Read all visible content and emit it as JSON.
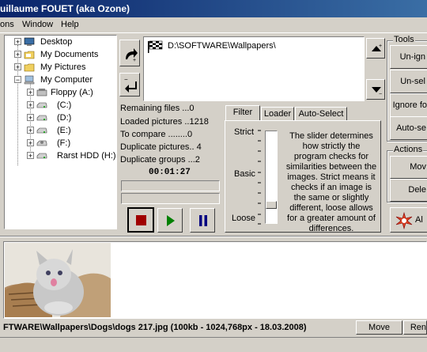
{
  "window": {
    "title": "uillaume FOUET (aka Ozone)"
  },
  "menu": {
    "items": [
      "ons",
      "Window",
      "Help"
    ]
  },
  "tree": {
    "items": [
      {
        "label": "Desktop",
        "icon": "desktop-icon"
      },
      {
        "label": "My Documents",
        "icon": "folder-icon"
      },
      {
        "label": "My Pictures",
        "icon": "folder-icon"
      },
      {
        "label": "My Computer",
        "icon": "computer-icon"
      },
      {
        "label": "Floppy (A:)",
        "icon": "floppy-icon"
      },
      {
        "label": "(C:)",
        "icon": "drive-icon"
      },
      {
        "label": "(D:)",
        "icon": "drive-icon"
      },
      {
        "label": "(E:)",
        "icon": "drive-icon"
      },
      {
        "label": "(F:)",
        "icon": "drive-icon"
      },
      {
        "label": "Rarst HDD (H:)",
        "icon": "drive-icon"
      }
    ]
  },
  "folders": {
    "path": "D:\\SOFTWARE\\Wallpapers\\"
  },
  "stats": {
    "remaining": "Remaining files ...0",
    "loaded": "Loaded pictures ..1218",
    "to_compare": "To compare ........0",
    "duplicates": "Duplicate pictures.. 4",
    "groups": "Duplicate groups ...2",
    "time": "00:01:27"
  },
  "tabs": [
    "Filter",
    "Loader",
    "Auto-Select"
  ],
  "filter": {
    "strict": "Strict",
    "basic": "Basic",
    "loose": "Loose",
    "description": "The slider determines how strictly the program checks for similarities between the images. Strict means it checks if an image is the same or slightly different, loose allows for a greater amount of differences."
  },
  "tools": {
    "title": "Tools",
    "buttons": [
      "Un-ign",
      "Un-sel",
      "Ignore fo",
      "Auto-se"
    ]
  },
  "actions": {
    "title": "Actions",
    "buttons": [
      "Mov",
      "Dele"
    ]
  },
  "bigbutton": {
    "label": "Al"
  },
  "status": {
    "path": "FTWARE\\Wallpapers\\Dogs\\dogs 217.jpg (100kb - 1024,768px - 18.03.2008)",
    "move": "Move",
    "rename": "Ren"
  },
  "colors": {
    "title_start": "#0a246a",
    "title_end": "#3a6ea5",
    "stop": "#a00000",
    "play": "#008000",
    "pause": "#000080"
  }
}
